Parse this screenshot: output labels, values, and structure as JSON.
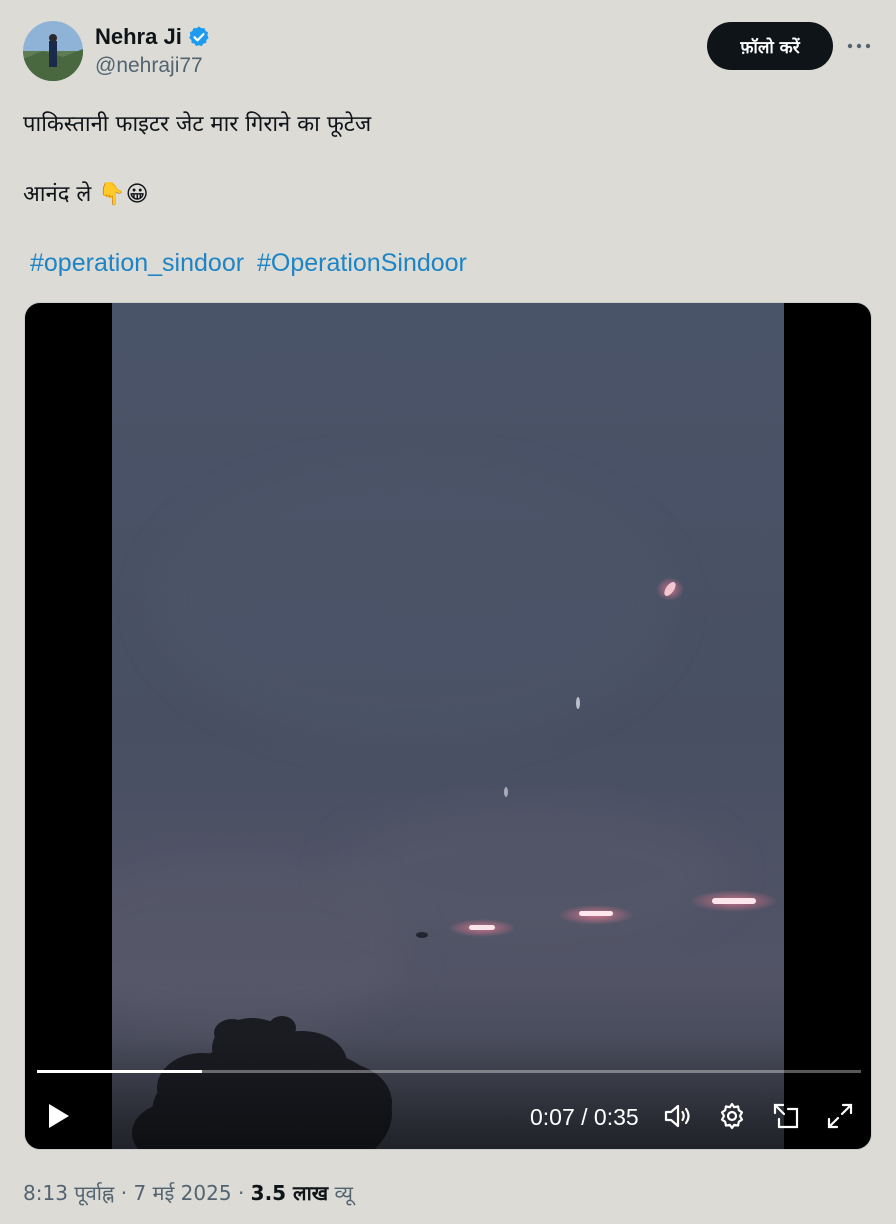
{
  "author": {
    "name": "Nehra Ji",
    "handle": "@nehraji77"
  },
  "follow_label": "फ़ॉलो करें",
  "tweet": {
    "line1": "पाकिस्तानी फाइटर जेट मार गिराने का फूटेज",
    "line2": "आनंद ले 👇😀",
    "hashtags": [
      "#operation_sindoor",
      "#OperationSindoor"
    ]
  },
  "video": {
    "time_display": "0:07 / 0:35",
    "progress": 0.2
  },
  "footer": {
    "time": "8:13 पूर्वाह्न",
    "date": "7 मई 2025",
    "views_count": "3.5 लाख",
    "views_label": "व्यू"
  },
  "colors": {
    "accent": "#1d9bf0",
    "hashtag": "#1d84c6",
    "button_bg": "#0f1419",
    "page_bg": "#dcdbd6"
  }
}
